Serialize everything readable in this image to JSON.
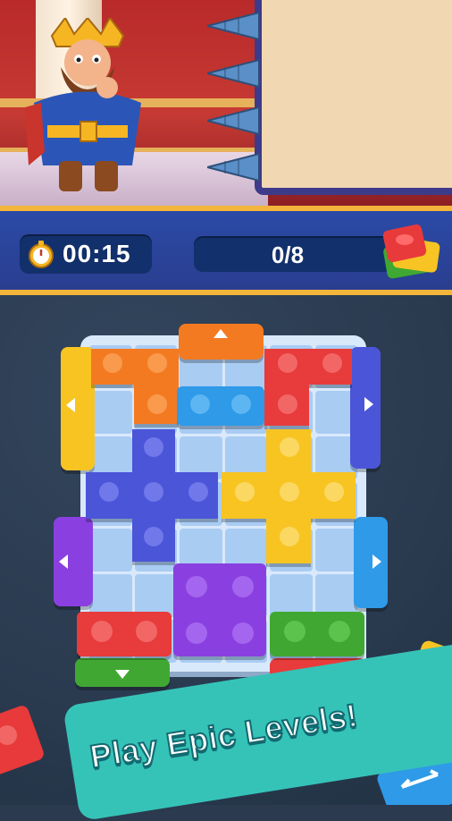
{
  "hud": {
    "timer": "00:15",
    "progress": "0/8"
  },
  "banner": {
    "text": "Play Epic Levels!"
  },
  "icons": [
    "stopwatch-icon",
    "blocks-stack-icon",
    "arrow-up-icon",
    "arrow-down-icon",
    "arrow-left-icon",
    "arrow-right-icon"
  ],
  "colors": {
    "orange": "#f47a22",
    "blue": "#2f9ae8",
    "red": "#e83a3a",
    "indigo": "#4b55d8",
    "yellow": "#f7c424",
    "purple": "#8a3fe0",
    "green": "#3fa832",
    "board": "#a9ccf3"
  }
}
